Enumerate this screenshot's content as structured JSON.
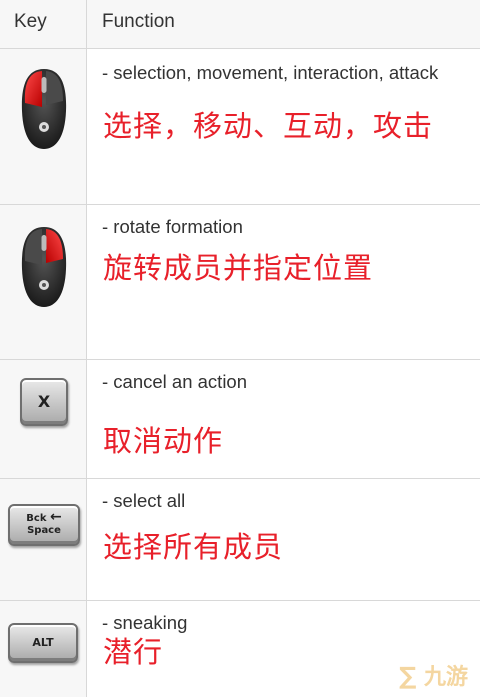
{
  "header": {
    "key_label": "Key",
    "function_label": "Function"
  },
  "rows": [
    {
      "icon": "mouse-left-click-icon",
      "en": "- selection, movement, interaction, attack",
      "zh": "选择，移动、互动，攻击"
    },
    {
      "icon": "mouse-right-click-icon",
      "en": "- rotate formation",
      "zh": "旋转成员并指定位置"
    },
    {
      "icon": "x-key-icon",
      "key": "X",
      "en": "- cancel an action",
      "zh": "取消动作"
    },
    {
      "icon": "backspace-key-icon",
      "key_top": "Bck",
      "key_bottom": "Space",
      "en": "- select all",
      "zh": "选择所有成员"
    },
    {
      "icon": "alt-key-icon",
      "key": "ALT",
      "en": "- sneaking",
      "zh": "潜行"
    }
  ],
  "watermark": "九游"
}
